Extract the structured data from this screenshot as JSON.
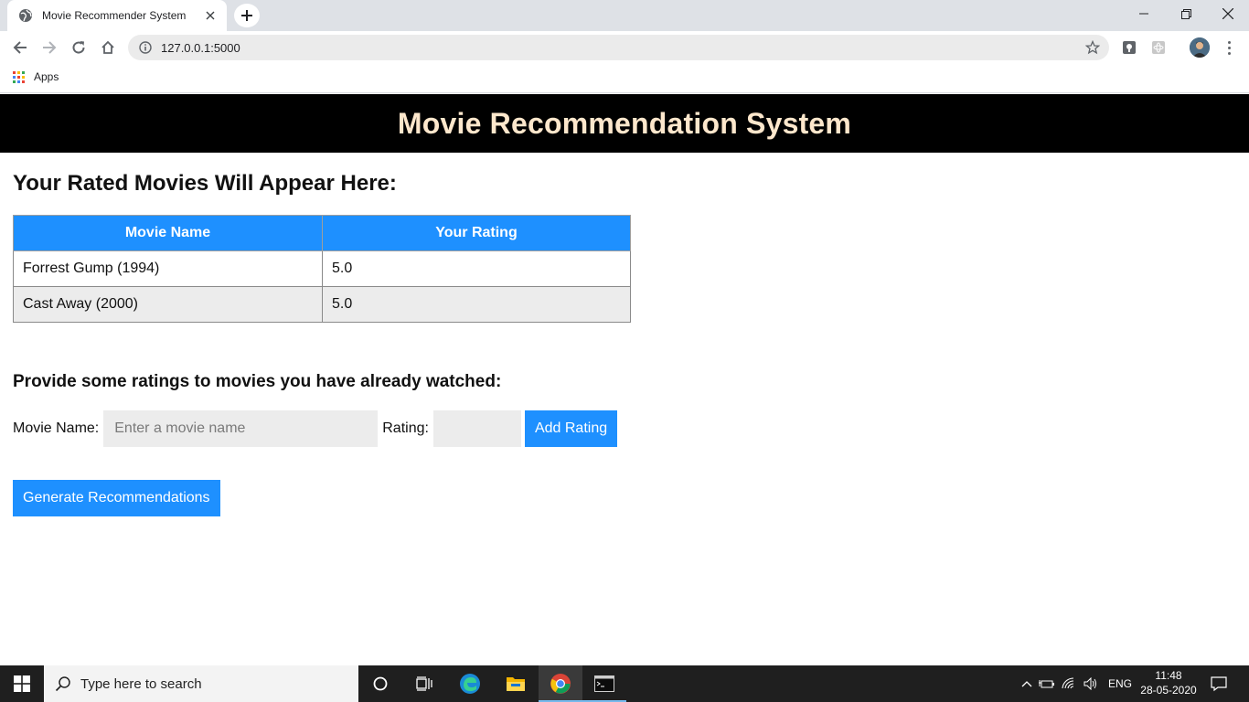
{
  "browser": {
    "tab_title": "Movie Recommender System",
    "url": "127.0.0.1:5000",
    "bookmarks_apps_label": "Apps"
  },
  "page": {
    "header_title": "Movie Recommendation System",
    "rated_section_title": "Your Rated Movies Will Appear Here:",
    "table": {
      "columns": [
        "Movie Name",
        "Your Rating"
      ],
      "rows": [
        {
          "movie": "Forrest Gump (1994)",
          "rating": "5.0"
        },
        {
          "movie": "Cast Away (2000)",
          "rating": "5.0"
        }
      ]
    },
    "prompt": "Provide some ratings to movies you have already watched:",
    "form": {
      "movie_label": "Movie Name:",
      "movie_placeholder": "Enter a movie name",
      "rating_label": "Rating:",
      "add_button": "Add Rating"
    },
    "generate_button": "Generate Recommendations",
    "colors": {
      "header_bg": "#000000",
      "header_text": "#fde7cc",
      "accent": "#1e90ff",
      "input_bg": "#ececec"
    }
  },
  "taskbar": {
    "search_placeholder": "Type here to search",
    "language": "ENG",
    "time": "11:48",
    "date": "28-05-2020"
  }
}
